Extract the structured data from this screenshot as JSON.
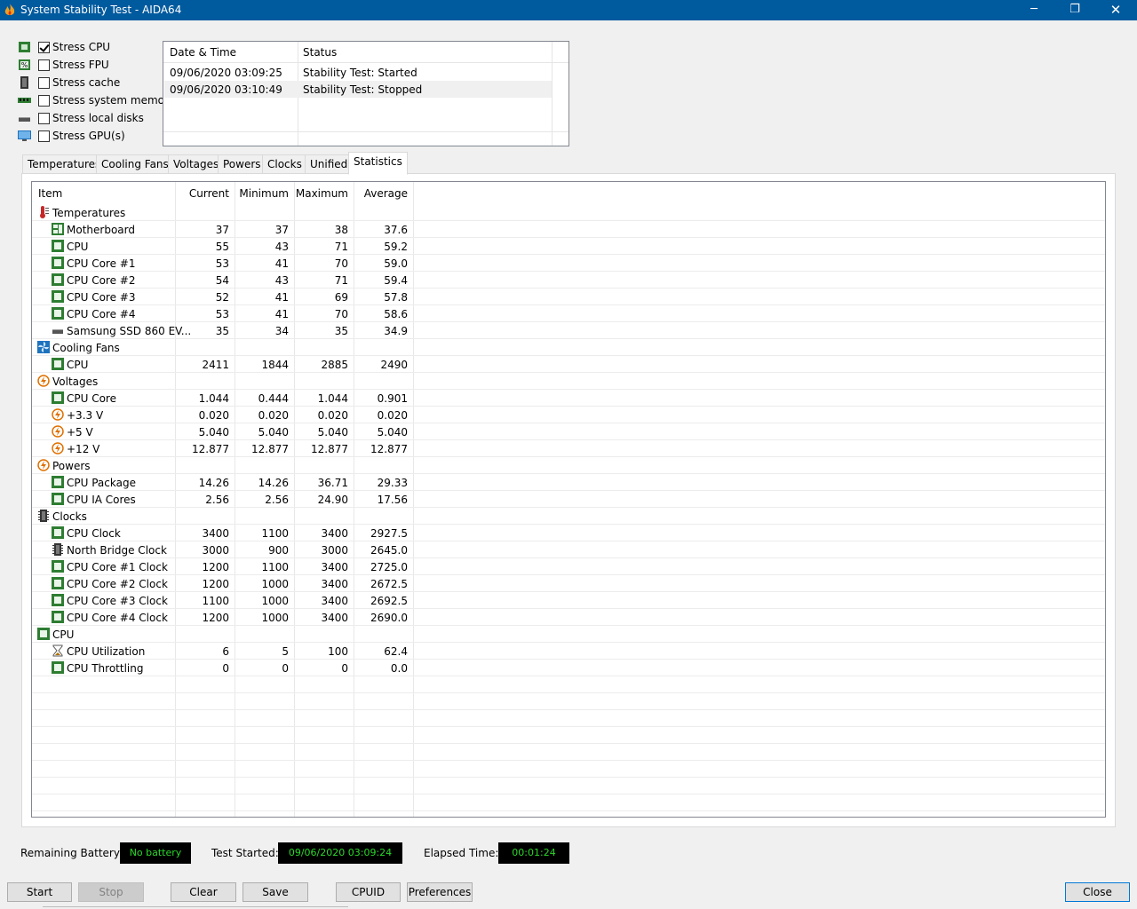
{
  "window": {
    "title": "System Stability Test - AIDA64",
    "minimize": "─",
    "maximize": "❐",
    "close": "✕"
  },
  "stress_options": [
    {
      "label": "Stress CPU",
      "checked": true,
      "icon": "cpu-chip-icon"
    },
    {
      "label": "Stress FPU",
      "checked": false,
      "icon": "fpu-icon"
    },
    {
      "label": "Stress cache",
      "checked": false,
      "icon": "cache-icon"
    },
    {
      "label": "Stress system memory",
      "checked": false,
      "icon": "memory-module-icon"
    },
    {
      "label": "Stress local disks",
      "checked": false,
      "icon": "disk-drive-icon"
    },
    {
      "label": "Stress GPU(s)",
      "checked": false,
      "icon": "monitor-icon"
    }
  ],
  "log": {
    "headers": [
      "Date & Time",
      "Status"
    ],
    "rows": [
      {
        "datetime": "09/06/2020 03:09:25",
        "status": "Stability Test: Started"
      },
      {
        "datetime": "09/06/2020 03:10:49",
        "status": "Stability Test: Stopped"
      }
    ]
  },
  "tabs": [
    "Temperatures",
    "Cooling Fans",
    "Voltages",
    "Powers",
    "Clocks",
    "Unified",
    "Statistics"
  ],
  "active_tab": "Statistics",
  "stats": {
    "headers": [
      "Item",
      "Current",
      "Minimum",
      "Maximum",
      "Average"
    ],
    "rows": [
      {
        "type": "group",
        "name": "Temperatures",
        "icon": "thermometer-icon"
      },
      {
        "type": "item",
        "name": "Motherboard",
        "icon": "motherboard-icon",
        "current": "37",
        "minimum": "37",
        "maximum": "38",
        "average": "37.6"
      },
      {
        "type": "item",
        "name": "CPU",
        "icon": "cpu-chip-icon",
        "current": "55",
        "minimum": "43",
        "maximum": "71",
        "average": "59.2"
      },
      {
        "type": "item",
        "name": "CPU Core #1",
        "icon": "cpu-chip-icon",
        "current": "53",
        "minimum": "41",
        "maximum": "70",
        "average": "59.0"
      },
      {
        "type": "item",
        "name": "CPU Core #2",
        "icon": "cpu-chip-icon",
        "current": "54",
        "minimum": "43",
        "maximum": "71",
        "average": "59.4"
      },
      {
        "type": "item",
        "name": "CPU Core #3",
        "icon": "cpu-chip-icon",
        "current": "52",
        "minimum": "41",
        "maximum": "69",
        "average": "57.8"
      },
      {
        "type": "item",
        "name": "CPU Core #4",
        "icon": "cpu-chip-icon",
        "current": "53",
        "minimum": "41",
        "maximum": "70",
        "average": "58.6"
      },
      {
        "type": "item",
        "name": "Samsung SSD 860 EV...",
        "icon": "disk-drive-icon",
        "current": "35",
        "minimum": "34",
        "maximum": "35",
        "average": "34.9"
      },
      {
        "type": "group",
        "name": "Cooling Fans",
        "icon": "fan-icon"
      },
      {
        "type": "item",
        "name": "CPU",
        "icon": "cpu-chip-icon",
        "current": "2411",
        "minimum": "1844",
        "maximum": "2885",
        "average": "2490"
      },
      {
        "type": "group",
        "name": "Voltages",
        "icon": "lightning-icon"
      },
      {
        "type": "item",
        "name": "CPU Core",
        "icon": "cpu-chip-icon",
        "current": "1.044",
        "minimum": "0.444",
        "maximum": "1.044",
        "average": "0.901"
      },
      {
        "type": "item",
        "name": "+3.3 V",
        "icon": "lightning-icon",
        "current": "0.020",
        "minimum": "0.020",
        "maximum": "0.020",
        "average": "0.020"
      },
      {
        "type": "item",
        "name": "+5 V",
        "icon": "lightning-icon",
        "current": "5.040",
        "minimum": "5.040",
        "maximum": "5.040",
        "average": "5.040"
      },
      {
        "type": "item",
        "name": "+12 V",
        "icon": "lightning-icon",
        "current": "12.877",
        "minimum": "12.877",
        "maximum": "12.877",
        "average": "12.877"
      },
      {
        "type": "group",
        "name": "Powers",
        "icon": "lightning-icon"
      },
      {
        "type": "item",
        "name": "CPU Package",
        "icon": "cpu-chip-icon",
        "current": "14.26",
        "minimum": "14.26",
        "maximum": "36.71",
        "average": "29.33"
      },
      {
        "type": "item",
        "name": "CPU IA Cores",
        "icon": "cpu-chip-icon",
        "current": "2.56",
        "minimum": "2.56",
        "maximum": "24.90",
        "average": "17.56"
      },
      {
        "type": "group",
        "name": "Clocks",
        "icon": "chip-pins-icon"
      },
      {
        "type": "item",
        "name": "CPU Clock",
        "icon": "cpu-chip-icon",
        "current": "3400",
        "minimum": "1100",
        "maximum": "3400",
        "average": "2927.5"
      },
      {
        "type": "item",
        "name": "North Bridge Clock",
        "icon": "chip-pins-icon",
        "current": "3000",
        "minimum": "900",
        "maximum": "3000",
        "average": "2645.0"
      },
      {
        "type": "item",
        "name": "CPU Core #1 Clock",
        "icon": "cpu-chip-icon",
        "current": "1200",
        "minimum": "1100",
        "maximum": "3400",
        "average": "2725.0"
      },
      {
        "type": "item",
        "name": "CPU Core #2 Clock",
        "icon": "cpu-chip-icon",
        "current": "1200",
        "minimum": "1000",
        "maximum": "3400",
        "average": "2672.5"
      },
      {
        "type": "item",
        "name": "CPU Core #3 Clock",
        "icon": "cpu-chip-icon",
        "current": "1100",
        "minimum": "1000",
        "maximum": "3400",
        "average": "2692.5"
      },
      {
        "type": "item",
        "name": "CPU Core #4 Clock",
        "icon": "cpu-chip-icon",
        "current": "1200",
        "minimum": "1000",
        "maximum": "3400",
        "average": "2690.0"
      },
      {
        "type": "group",
        "name": "CPU",
        "icon": "cpu-chip-icon"
      },
      {
        "type": "item",
        "name": "CPU Utilization",
        "icon": "hourglass-icon",
        "current": "6",
        "minimum": "5",
        "maximum": "100",
        "average": "62.4"
      },
      {
        "type": "item",
        "name": "CPU Throttling",
        "icon": "cpu-chip-icon",
        "current": "0",
        "minimum": "0",
        "maximum": "0",
        "average": "0.0"
      }
    ]
  },
  "status_bar": {
    "battery_label": "Remaining Battery:",
    "battery_value": "No battery",
    "started_label": "Test Started:",
    "started_value": "09/06/2020 03:09:24",
    "elapsed_label": "Elapsed Time:",
    "elapsed_value": "00:01:24"
  },
  "buttons": {
    "start": "Start",
    "stop": "Stop",
    "clear": "Clear",
    "save": "Save",
    "cpuid": "CPUID",
    "preferences": "Preferences",
    "close": "Close"
  },
  "colors": {
    "titlebar": "#005a9e",
    "status_text": "#29d929",
    "status_bg": "#000000"
  }
}
